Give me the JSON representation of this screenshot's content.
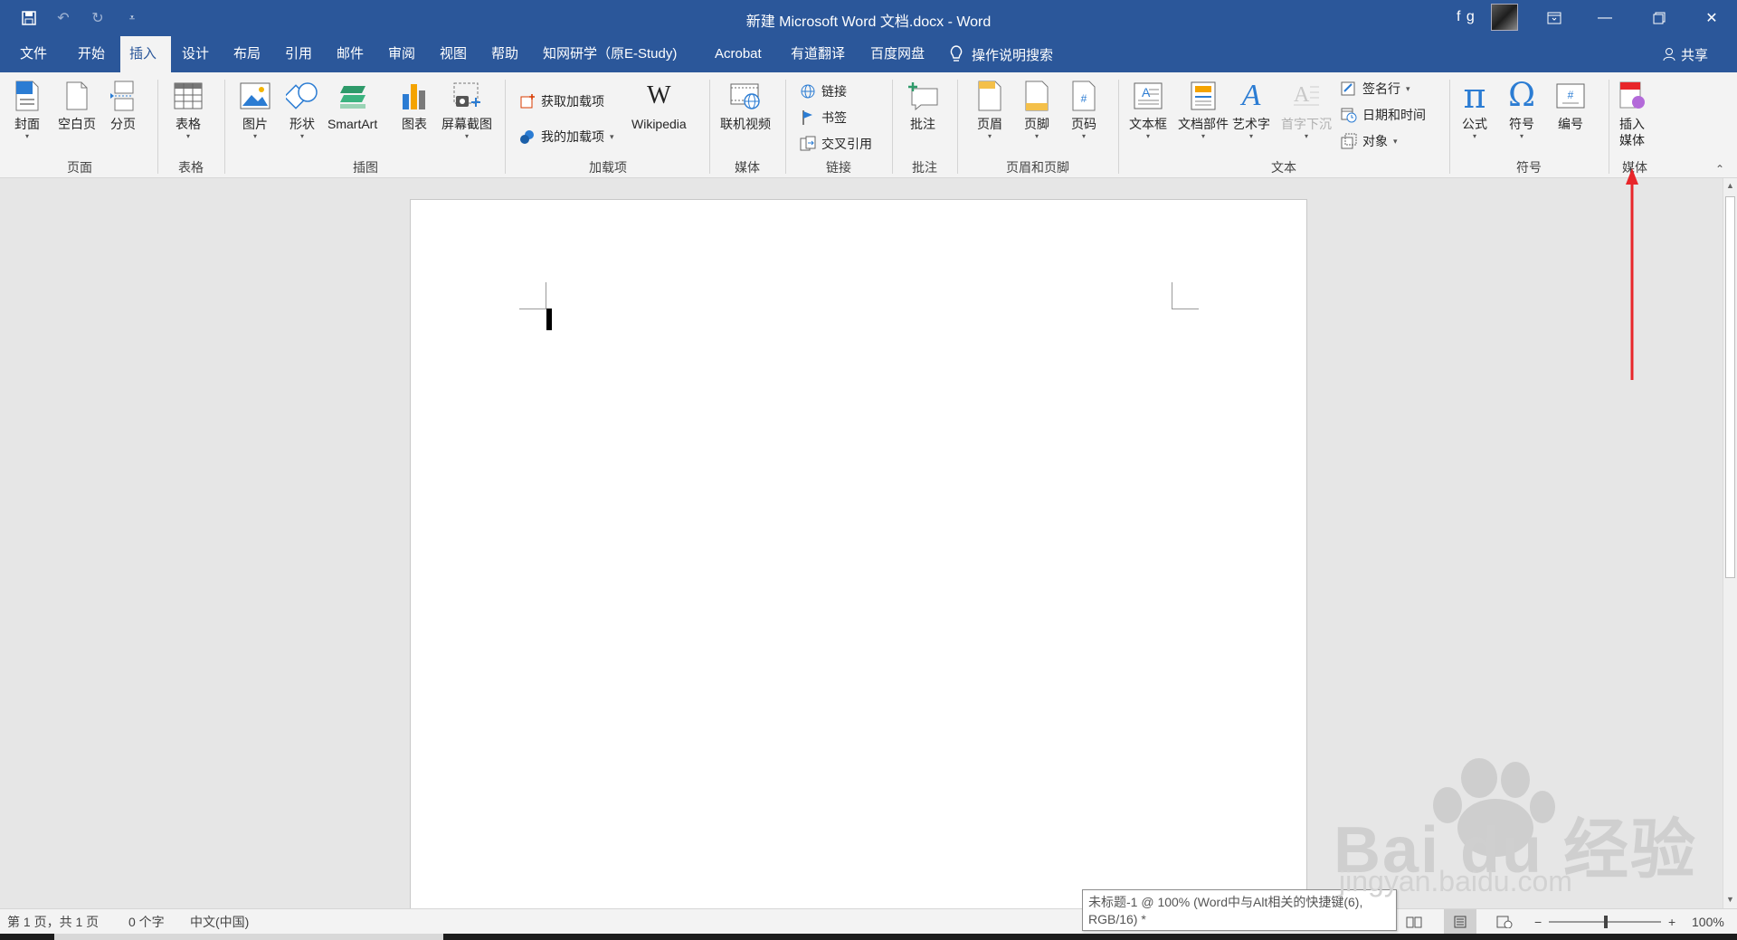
{
  "titlebar": {
    "title": "新建 Microsoft Word 文档.docx  -  Word",
    "user": "f g",
    "qat": [
      "save-icon",
      "undo-icon",
      "redo-icon",
      "customize-icon"
    ],
    "window_buttons": [
      "ribbon-display-icon",
      "minimize-icon",
      "restore-icon",
      "close-icon"
    ]
  },
  "tabs": [
    {
      "label": "文件"
    },
    {
      "label": "开始"
    },
    {
      "label": "插入"
    },
    {
      "label": "设计"
    },
    {
      "label": "布局"
    },
    {
      "label": "引用"
    },
    {
      "label": "邮件"
    },
    {
      "label": "审阅"
    },
    {
      "label": "视图"
    },
    {
      "label": "帮助"
    },
    {
      "label": "知网研学（原E-Study)"
    },
    {
      "label": "Acrobat"
    },
    {
      "label": "有道翻译"
    },
    {
      "label": "百度网盘"
    }
  ],
  "active_tab": "插入",
  "tell_me": "操作说明搜索",
  "share": "共享",
  "ribbon": {
    "pages": {
      "label": "页面",
      "items": [
        "封面",
        "空白页",
        "分页"
      ]
    },
    "tables": {
      "label": "表格",
      "items": [
        "表格"
      ]
    },
    "illustrations": {
      "label": "插图",
      "items": [
        "图片",
        "形状",
        "SmartArt",
        "图表",
        "屏幕截图"
      ]
    },
    "addins": {
      "label": "加载项",
      "items": [
        "获取加载项",
        "我的加载项",
        "Wikipedia"
      ]
    },
    "media": {
      "label": "媒体",
      "items": [
        "联机视频"
      ]
    },
    "links": {
      "label": "链接",
      "items": [
        "链接",
        "书签",
        "交叉引用"
      ]
    },
    "comments": {
      "label": "批注",
      "items": [
        "批注"
      ]
    },
    "header_footer": {
      "label": "页眉和页脚",
      "items": [
        "页眉",
        "页脚",
        "页码"
      ]
    },
    "text": {
      "label": "文本",
      "items": [
        "文本框",
        "文档部件",
        "艺术字",
        "首字下沉",
        "签名行",
        "日期和时间",
        "对象"
      ]
    },
    "symbols": {
      "label": "符号",
      "items": [
        "公式",
        "符号",
        "编号"
      ]
    },
    "media2": {
      "label": "媒体",
      "items": [
        "插入",
        "媒体"
      ]
    }
  },
  "status": {
    "page": "第 1 页，共 1 页",
    "words": "0 个字",
    "language": "中文(中国)",
    "zoom": "100%",
    "zoom_minus": "−",
    "zoom_plus": "+"
  },
  "tooltip": {
    "line1": "未标题-1 @ 100% (Word中与Alt相关的快捷键(6),",
    "line2": "RGB/16) *"
  },
  "watermark": {
    "brand": "Bai du 经验",
    "url": "jingyan.baidu.com"
  },
  "colors": {
    "accent": "#2b579a",
    "ribbon_bg": "#f3f3f3",
    "annotation": "#e8262a"
  }
}
